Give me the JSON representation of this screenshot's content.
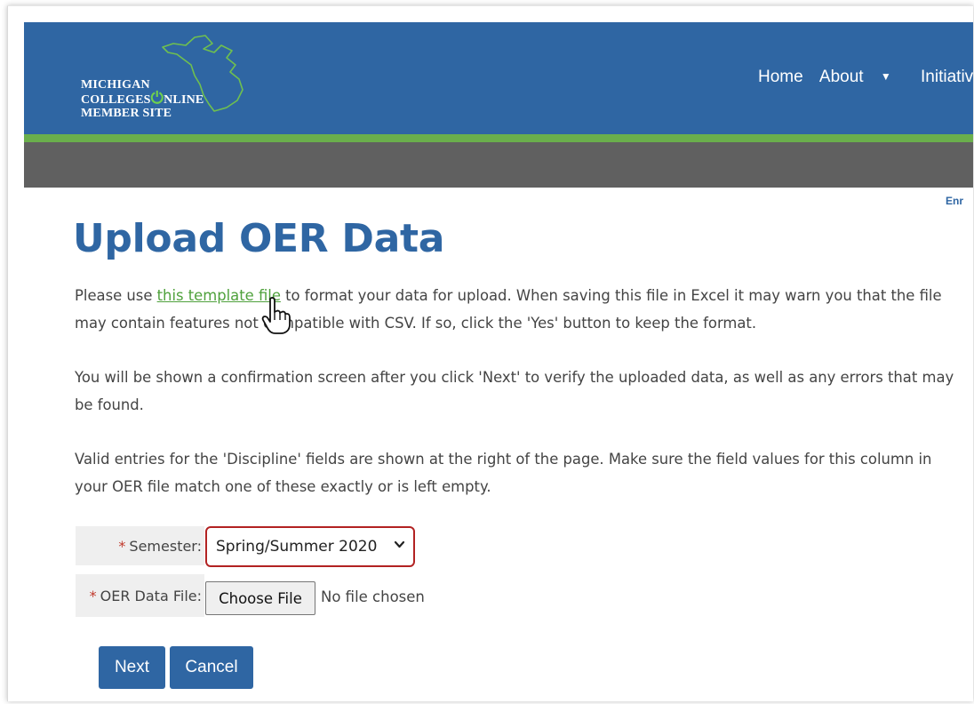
{
  "header": {
    "logo": {
      "line1": "MICHIGAN",
      "line2a": "COLLEGES",
      "line2b": "NLINE",
      "line3": "MEMBER SITE",
      "power_icon": "power-icon"
    },
    "nav": {
      "home": "Home",
      "about": "About",
      "initiatives": "Initiativ"
    },
    "right_fragment": "Enr"
  },
  "page": {
    "title": "Upload OER Data",
    "p1_before": "Please use ",
    "p1_link": "this template file",
    "p1_after": " to format your data for upload. When saving this file in Excel it may warn you that the file may contain features not compatible with CSV. If so, click the 'Yes' button to keep the format.",
    "p2": "You will be shown a confirmation screen after you click 'Next' to verify the uploaded data, as well as any errors that may be found.",
    "p3": "Valid entries for the 'Discipline' fields are shown at the right of the page. Make sure the field values for this column in your OER file match one of these exactly or is left empty."
  },
  "form": {
    "required_mark": "*",
    "semester_label": "Semester:",
    "semester_value": "Spring/Summer 2020",
    "file_label": "OER Data File:",
    "choose_file": "Choose File",
    "no_file": "No file chosen"
  },
  "buttons": {
    "next": "Next",
    "cancel": "Cancel"
  },
  "colors": {
    "brand_blue": "#2f66a3",
    "accent_green": "#6aaf4c",
    "gray_bar": "#606060",
    "error_red": "#b22222"
  }
}
